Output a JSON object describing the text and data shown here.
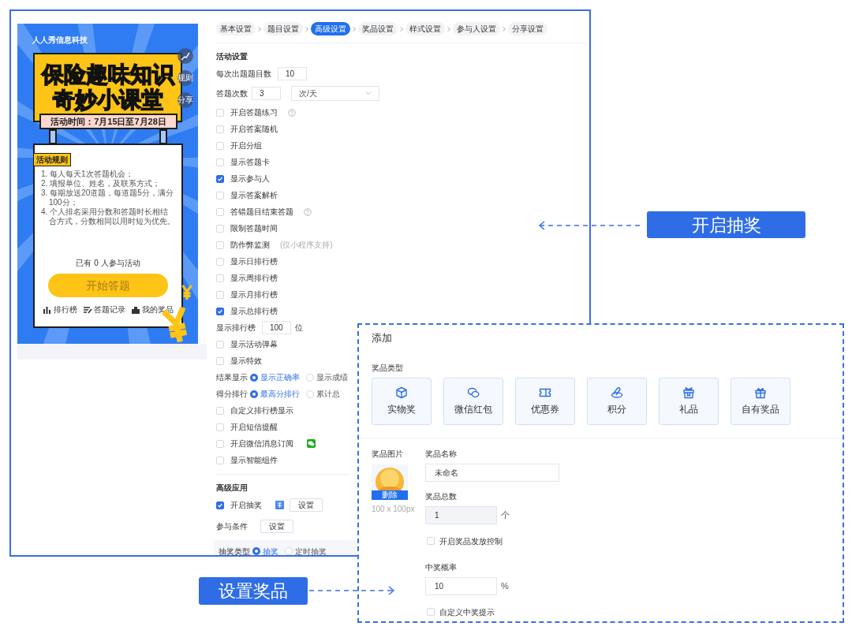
{
  "preview": {
    "company": "人人秀信息科技",
    "title_lines": [
      "保险趣味知识",
      "奇妙小课堂"
    ],
    "date": "活动时间：7月15日至7月28日",
    "side_buttons": [
      {
        "kind": "icon"
      },
      {
        "kind": "text",
        "label": "规则"
      },
      {
        "kind": "text",
        "label": "分享"
      }
    ],
    "rules_heading": "活动规则",
    "rules": [
      "1. 每人每天1次答题机会；",
      "2. 填报单位、姓名，及联系方式；",
      "3. 每期放送20道题，每道题5分，满分100分；",
      "4. 个人排名采用分数和答题时长相结合方式，分数相同以用时短为优先。"
    ],
    "participants": "已有 0 人参与活动",
    "start_button": "开始答题",
    "links": [
      {
        "label": "排行榜"
      },
      {
        "label": "答题记录"
      },
      {
        "label": "我的奖品"
      }
    ]
  },
  "tabs": [
    {
      "label": "基本设置",
      "selected": false
    },
    {
      "label": "题目设置",
      "selected": false
    },
    {
      "label": "高级设置",
      "selected": true
    },
    {
      "label": "奖品设置",
      "selected": false
    },
    {
      "label": "样式设置",
      "selected": false
    },
    {
      "label": "参与人设置",
      "selected": false
    },
    {
      "label": "分享设置",
      "selected": false
    }
  ],
  "activity_settings": {
    "heading": "活动设置",
    "rows": [
      {
        "kind": "number",
        "label": "每次出题题目数",
        "value": "10"
      },
      {
        "kind": "number_select",
        "label": "答题次数",
        "value": "3",
        "select": "次/天"
      },
      {
        "kind": "checkbox",
        "label": "开启答题练习",
        "checked": false,
        "help": true
      },
      {
        "kind": "checkbox",
        "label": "开启答案随机",
        "checked": false
      },
      {
        "kind": "checkbox",
        "label": "开启分组",
        "checked": false
      },
      {
        "kind": "checkbox",
        "label": "显示答题卡",
        "checked": false
      },
      {
        "kind": "checkbox",
        "label": "显示参与人",
        "checked": true
      },
      {
        "kind": "checkbox",
        "label": "显示答案解析",
        "checked": false
      },
      {
        "kind": "checkbox",
        "label": "答错题目结束答题",
        "checked": false,
        "help": true
      },
      {
        "kind": "checkbox",
        "label": "限制答题时间",
        "checked": false
      },
      {
        "kind": "checkbox",
        "label": "防作弊监测",
        "checked": false,
        "note": "(仅小程序支持)"
      },
      {
        "kind": "checkbox",
        "label": "显示日排行榜",
        "checked": false
      },
      {
        "kind": "checkbox",
        "label": "显示周排行榜",
        "checked": false
      },
      {
        "kind": "checkbox",
        "label": "显示月排行榜",
        "checked": false
      },
      {
        "kind": "checkbox",
        "label": "显示总排行榜",
        "checked": true
      },
      {
        "kind": "number",
        "label": "显示排行榜",
        "value": "100",
        "unit": "位"
      },
      {
        "kind": "checkbox",
        "label": "显示活动弹幕",
        "checked": false
      },
      {
        "kind": "checkbox",
        "label": "显示特效",
        "checked": false
      },
      {
        "kind": "radio",
        "label": "结果显示",
        "options": [
          {
            "label": "显示正确率",
            "selected": true
          },
          {
            "label": "显示成绩",
            "selected": false
          }
        ]
      },
      {
        "kind": "radio",
        "label": "得分排行",
        "options": [
          {
            "label": "最高分排行",
            "selected": true
          },
          {
            "label": "累计总",
            "selected": false
          }
        ]
      },
      {
        "kind": "checkbox",
        "label": "自定义排行榜显示",
        "checked": false
      },
      {
        "kind": "checkbox",
        "label": "开启短信提醒",
        "checked": false
      },
      {
        "kind": "checkbox",
        "label": "开启微信消息订阅",
        "checked": false,
        "wechat": true
      },
      {
        "kind": "checkbox",
        "label": "显示智能组件",
        "checked": false
      }
    ]
  },
  "advanced": {
    "heading": "高级应用",
    "rows": [
      {
        "kind": "checkbox",
        "label": "开启抽奖",
        "checked": true,
        "tag_icon": true,
        "button": "设置"
      },
      {
        "kind": "button",
        "label": "参与条件",
        "button": "设置"
      },
      {
        "kind": "radio_panel",
        "label": "抽奖类型",
        "options": [
          {
            "label": "抽奖",
            "selected": true
          },
          {
            "label": "定时抽奖",
            "selected": false
          }
        ]
      }
    ]
  },
  "callouts": [
    {
      "label": "开启抽奖"
    },
    {
      "label": "设置奖品"
    }
  ],
  "prize_dialog": {
    "title": "添加",
    "type_heading": "奖品类型",
    "types": [
      "实物奖",
      "微信红包",
      "优惠券",
      "积分",
      "礼品",
      "自有奖品"
    ],
    "image_label": "奖品图片",
    "delete_button": "删除",
    "image_size": "100 x 100px",
    "name_label": "奖品名称",
    "name_value": "未命名",
    "total_label": "奖品总数",
    "total_value": "1",
    "total_unit": "个",
    "control_checkbox": {
      "label": "开启奖品发放控制",
      "checked": false
    },
    "rate_label": "中奖概率",
    "rate_value": "10",
    "rate_unit": "%",
    "tip_checkbox": {
      "label": "自定义中奖提示",
      "checked": false
    }
  }
}
